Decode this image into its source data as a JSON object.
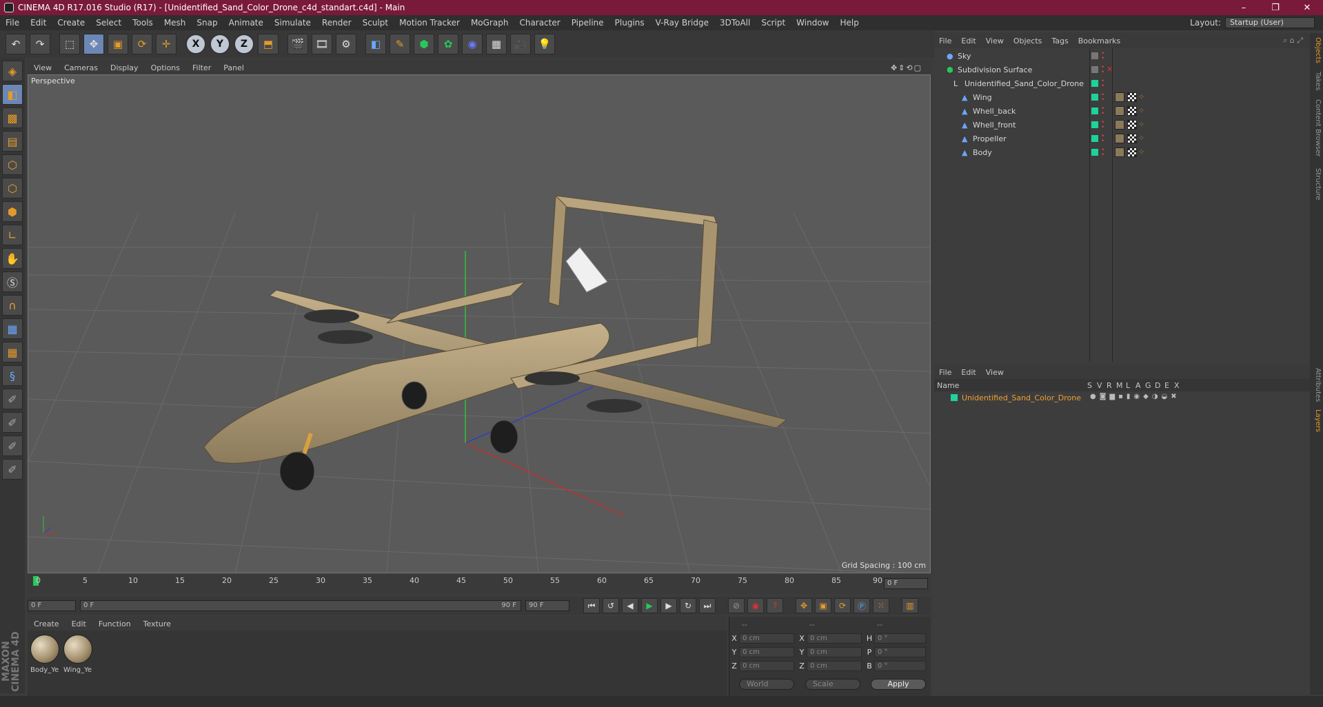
{
  "window": {
    "title": "CINEMA 4D R17.016 Studio (R17) - [Unidentified_Sand_Color_Drone_c4d_standart.c4d] - Main",
    "controls": [
      "–",
      "❐",
      "✕"
    ]
  },
  "menubar": {
    "items": [
      "File",
      "Edit",
      "Create",
      "Select",
      "Tools",
      "Mesh",
      "Snap",
      "Animate",
      "Simulate",
      "Render",
      "Sculpt",
      "Motion Tracker",
      "MoGraph",
      "Character",
      "Pipeline",
      "Plugins",
      "V-Ray Bridge",
      "3DToAll",
      "Script",
      "Window",
      "Help"
    ],
    "layout_label": "Layout:",
    "layout_value": "Startup (User)"
  },
  "toolbar": {
    "icons": [
      "undo-icon",
      "redo-icon",
      "live-select-icon",
      "move-icon",
      "scale-icon",
      "rotate-icon",
      "transform-icon",
      "x-axis-icon",
      "y-axis-icon",
      "z-axis-icon",
      "coordinate-system-icon",
      "render-view-icon",
      "render-picture-viewer-icon",
      "render-settings-icon",
      "cube-icon",
      "pen-icon",
      "subdivision-icon",
      "array-icon",
      "deformer-icon",
      "floor-icon",
      "camera-icon",
      "light-icon"
    ],
    "axis_labels": [
      "X",
      "Y",
      "Z"
    ]
  },
  "viewport": {
    "menu": [
      "View",
      "Cameras",
      "Display",
      "Options",
      "Filter",
      "Panel"
    ],
    "label": "Perspective",
    "grid_spacing": "Grid Spacing : 100 cm",
    "nav_icons": "✥⇕⟲▢"
  },
  "timeline": {
    "ticks": [
      "0",
      "5",
      "10",
      "15",
      "20",
      "25",
      "30",
      "35",
      "40",
      "45",
      "50",
      "55",
      "60",
      "65",
      "70",
      "75",
      "80",
      "85",
      "90"
    ],
    "current_frame": "0 F"
  },
  "transport": {
    "start": "0 F",
    "range_start": "0 F",
    "range_end": "90 F",
    "end": "90 F"
  },
  "materials": {
    "menu": [
      "Create",
      "Edit",
      "Function",
      "Texture"
    ],
    "items": [
      "Body_Ye",
      "Wing_Ye"
    ]
  },
  "coordinates": {
    "headers": [
      "--",
      "--",
      "--"
    ],
    "rows": [
      {
        "a": "X",
        "av": "0 cm",
        "b": "X",
        "bv": "0 cm",
        "c": "H",
        "cv": "0 °"
      },
      {
        "a": "Y",
        "av": "0 cm",
        "b": "Y",
        "bv": "0 cm",
        "c": "P",
        "cv": "0 °"
      },
      {
        "a": "Z",
        "av": "0 cm",
        "b": "Z",
        "bv": "0 cm",
        "c": "B",
        "cv": "0 °"
      }
    ],
    "mode1": "World",
    "mode2": "Scale",
    "apply": "Apply"
  },
  "object_manager": {
    "menu": [
      "File",
      "Edit",
      "View",
      "Objects",
      "Tags",
      "Bookmarks"
    ],
    "objects": [
      {
        "name": "Sky",
        "indent": 0
      },
      {
        "name": "Subdivision Surface",
        "indent": 0
      },
      {
        "name": "Unidentified_Sand_Color_Drone",
        "indent": 1
      },
      {
        "name": "Wing",
        "indent": 2
      },
      {
        "name": "Whell_back",
        "indent": 2
      },
      {
        "name": "Whell_front",
        "indent": 2
      },
      {
        "name": "Propeller",
        "indent": 2
      },
      {
        "name": "Body",
        "indent": 2
      }
    ]
  },
  "layer_manager": {
    "menu": [
      "File",
      "Edit",
      "View"
    ],
    "columns": [
      "Name",
      "S",
      "V",
      "R",
      "M",
      "L",
      "A",
      "G",
      "D",
      "E",
      "X"
    ],
    "layers": [
      {
        "name": "Unidentified_Sand_Color_Drone",
        "color": "#1ed29c"
      }
    ]
  },
  "right_tabs": [
    "Objects",
    "Takes",
    "Content Browser",
    "Structure",
    "Attributes",
    "Layers"
  ],
  "colors": {
    "accent": "#e49a2a",
    "title_bar": "#7a1a3a",
    "layer_name": "#f0a030"
  },
  "brand": "MAXON CINEMA 4D"
}
